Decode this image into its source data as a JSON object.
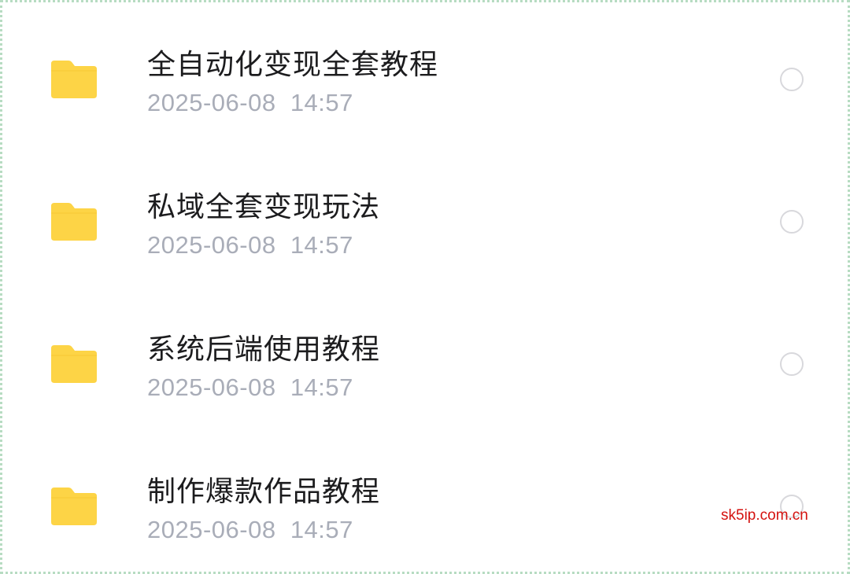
{
  "files": [
    {
      "name": "全自动化变现全套教程",
      "date": "2025-06-08",
      "time": "14:57",
      "icon": "folder-icon"
    },
    {
      "name": "私域全套变现玩法",
      "date": "2025-06-08",
      "time": "14:57",
      "icon": "folder-icon"
    },
    {
      "name": "系统后端使用教程",
      "date": "2025-06-08",
      "time": "14:57",
      "icon": "folder-icon"
    },
    {
      "name": "制作爆款作品教程",
      "date": "2025-06-08",
      "time": "14:57",
      "icon": "folder-icon"
    }
  ],
  "watermark": "sk5ip.com.cn",
  "colors": {
    "folder": "#fdd446",
    "title": "#1c1c1e",
    "meta": "#a9adb8",
    "radio_border": "#d8d8dc",
    "watermark": "#d4120f"
  }
}
